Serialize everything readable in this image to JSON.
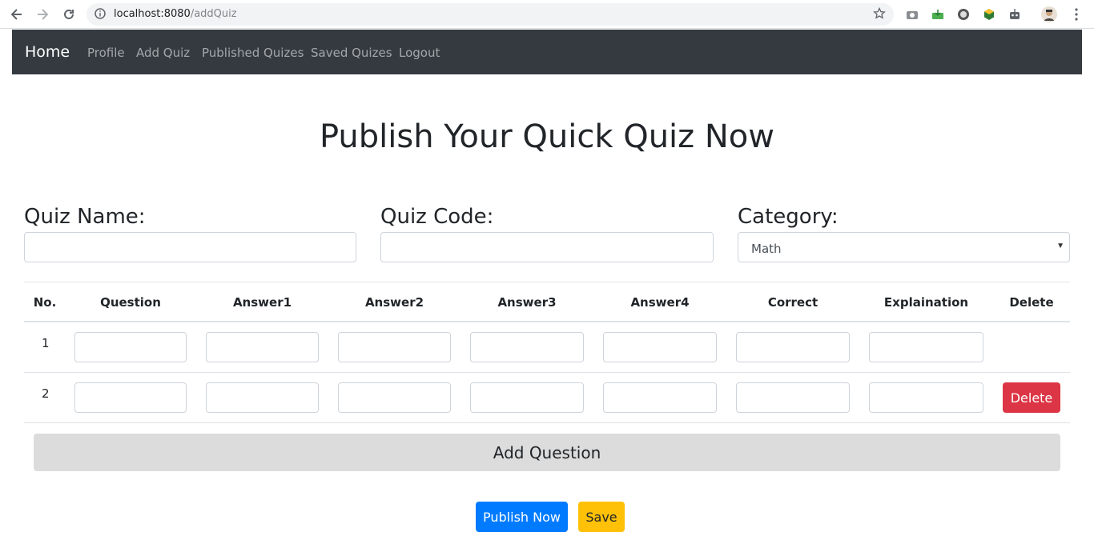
{
  "browser": {
    "url_host": "localhost:8080",
    "url_path": "/addQuiz"
  },
  "navbar": {
    "brand": "Home",
    "links": [
      "Profile",
      "Add Quiz",
      "Published Quizes",
      "Saved Quizes",
      "Logout"
    ]
  },
  "page": {
    "title": "Publish Your Quick Quiz Now"
  },
  "form": {
    "quiz_name_label": "Quiz Name:",
    "quiz_name_value": "",
    "quiz_code_label": "Quiz Code:",
    "quiz_code_value": "",
    "category_label": "Category:",
    "category_value": "Math"
  },
  "table": {
    "headers": [
      "No.",
      "Question",
      "Answer1",
      "Answer2",
      "Answer3",
      "Answer4",
      "Correct",
      "Explaination",
      "Delete"
    ],
    "rows": [
      {
        "no": "1",
        "question": "",
        "answer1": "",
        "answer2": "",
        "answer3": "",
        "answer4": "",
        "correct": "",
        "explanation": ""
      },
      {
        "no": "2",
        "question": "",
        "answer1": "",
        "answer2": "",
        "answer3": "",
        "answer4": "",
        "correct": "",
        "explanation": "",
        "delete_label": "Delete"
      }
    ]
  },
  "actions": {
    "add_question": "Add Question",
    "publish": "Publish Now",
    "save": "Save"
  },
  "colors": {
    "navbar": "#343a40",
    "primary": "#007bff",
    "danger": "#dc3545",
    "warning": "#ffc107"
  }
}
